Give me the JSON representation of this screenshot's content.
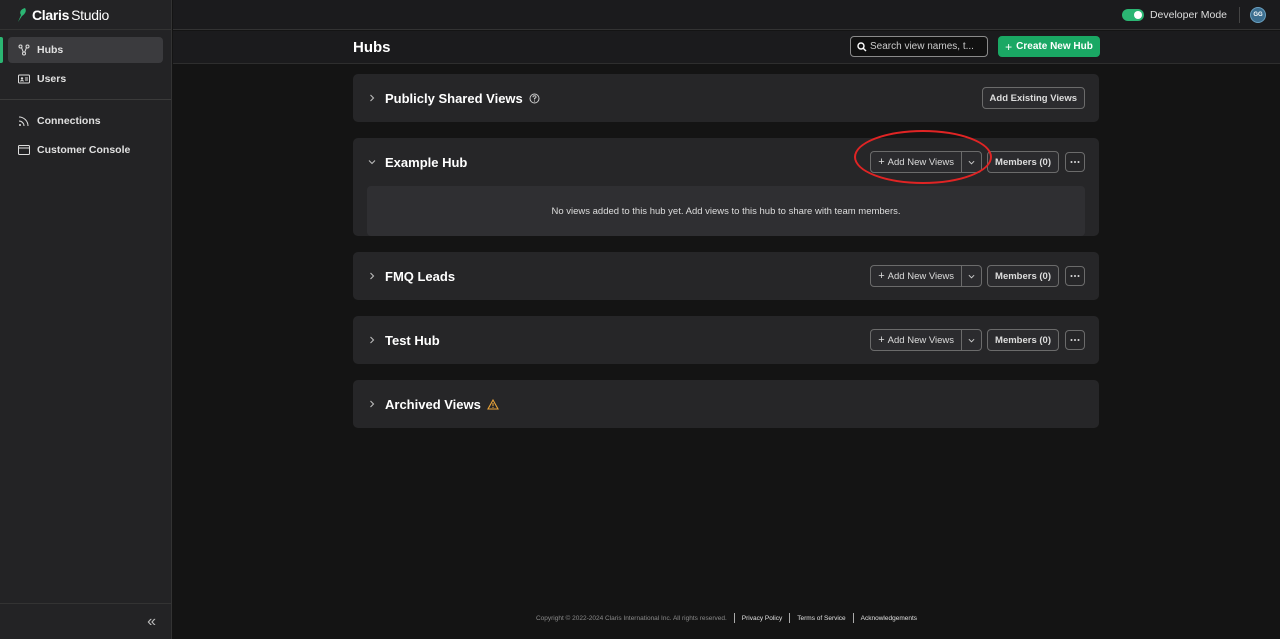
{
  "brand": {
    "name": "Claris",
    "product": "Studio"
  },
  "sidebar": {
    "items": [
      {
        "label": "Hubs",
        "icon": "hub-icon",
        "active": true
      },
      {
        "label": "Users",
        "icon": "id-card-icon",
        "active": false
      },
      {
        "label": "Connections",
        "icon": "rss-icon",
        "active": false
      },
      {
        "label": "Customer Console",
        "icon": "window-icon",
        "active": false
      }
    ],
    "collapse_glyph": "«"
  },
  "topbar": {
    "developer_mode_label": "Developer Mode",
    "developer_mode_on": true,
    "avatar_initials": "GG"
  },
  "header": {
    "title": "Hubs",
    "search_placeholder": "Search view names, t...",
    "create_label": "Create New Hub"
  },
  "cards": {
    "public": {
      "title": "Publicly Shared Views",
      "action": "Add Existing Views"
    },
    "example": {
      "title": "Example Hub",
      "add_label": "Add New Views",
      "members_label": "Members (0)",
      "empty_text": "No views added to this hub yet. Add views to this hub to share with team members."
    },
    "fmq": {
      "title": "FMQ Leads",
      "add_label": "Add New Views",
      "members_label": "Members (0)"
    },
    "test": {
      "title": "Test Hub",
      "add_label": "Add New Views",
      "members_label": "Members (0)"
    },
    "archived": {
      "title": "Archived Views"
    }
  },
  "footer": {
    "copyright": "Copyright © 2022-2024 Claris International Inc. All rights reserved.",
    "privacy": "Privacy Policy",
    "terms": "Terms of Service",
    "ack": "Acknowledgements"
  },
  "colors": {
    "accent": "#1aa864",
    "annotation": "#e02424",
    "warning": "#e8a33a"
  }
}
